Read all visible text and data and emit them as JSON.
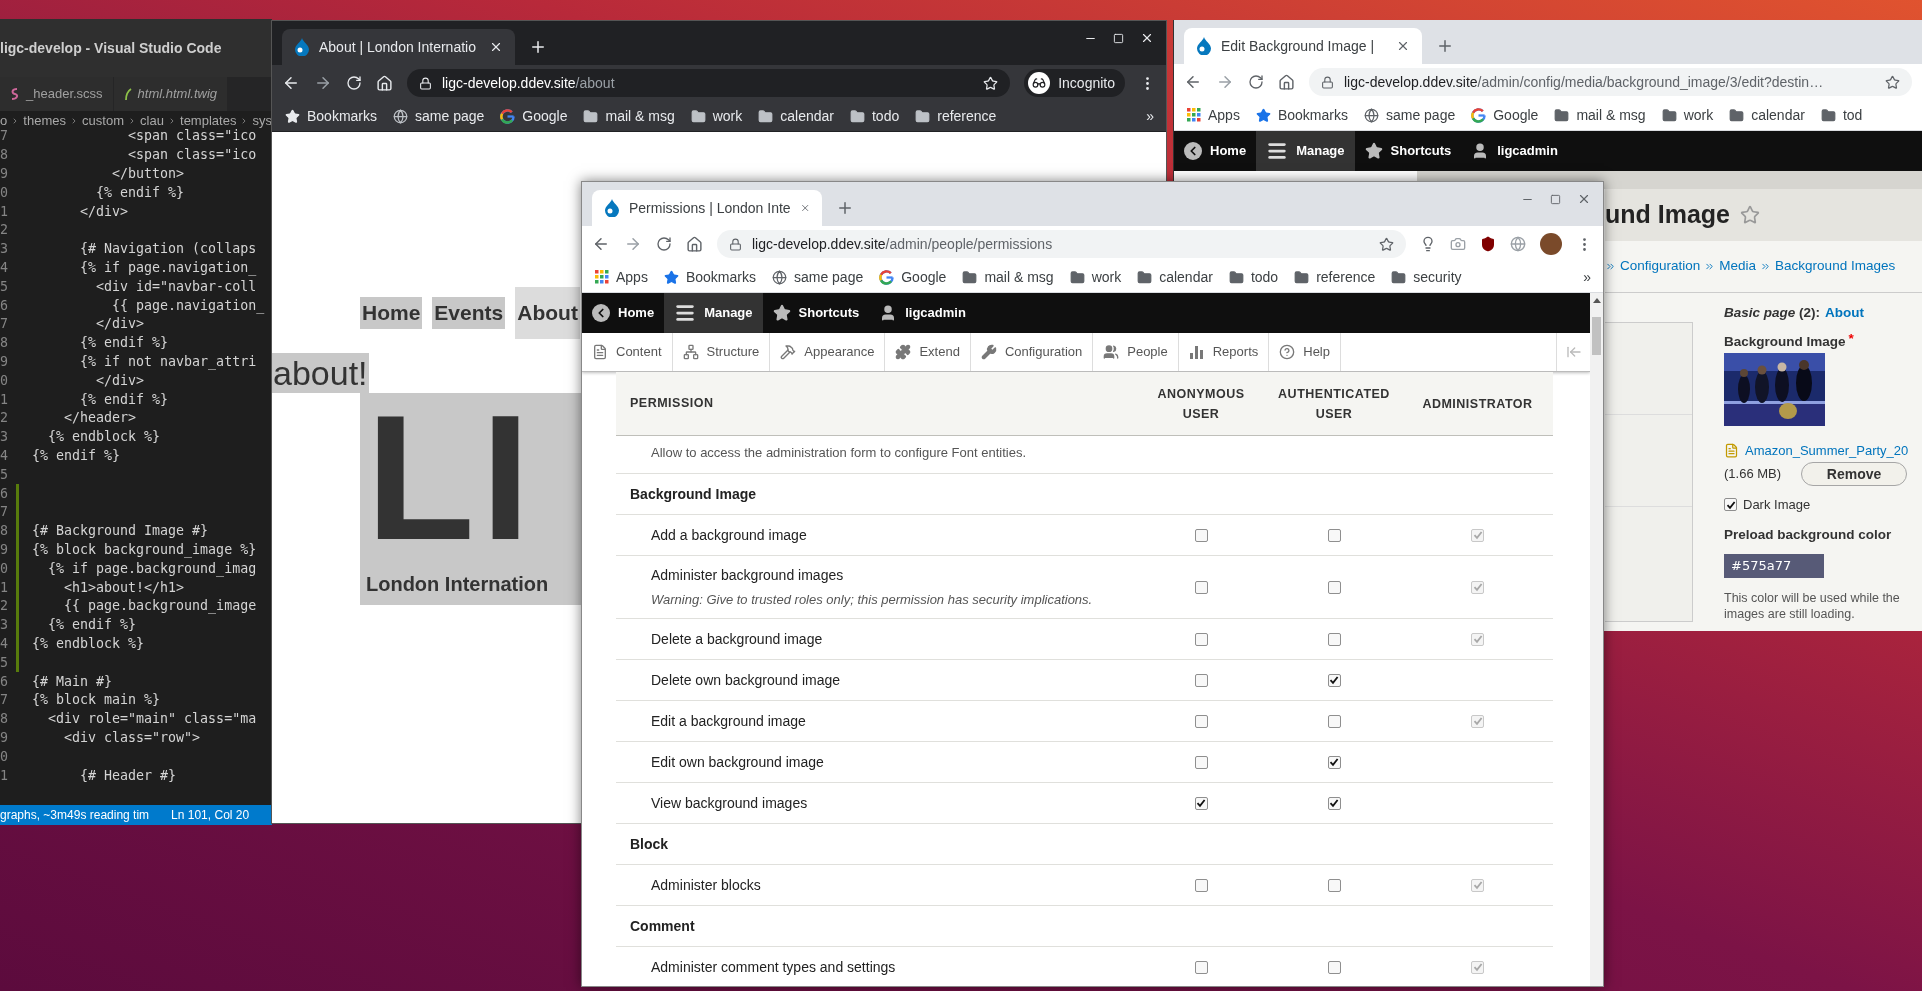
{
  "vscode": {
    "title": "ligc-develop - Visual Studio Code",
    "tabs": [
      {
        "label": "_header.scss",
        "kind": "scss"
      },
      {
        "label": "html.html.twig",
        "kind": "preview"
      }
    ],
    "breadcrumb": [
      "o",
      "themes",
      "custom",
      "clau",
      "templates",
      "sys"
    ],
    "lines": [
      {
        "number": "7",
        "text": "            <span class=\"ico",
        "modified": false
      },
      {
        "number": "8",
        "text": "            <span class=\"ico",
        "modified": false
      },
      {
        "number": "9",
        "text": "          </button>",
        "modified": false
      },
      {
        "number": "0",
        "text": "        {% endif %}",
        "modified": false
      },
      {
        "number": "1",
        "text": "      </div>",
        "modified": false
      },
      {
        "number": "2",
        "modified": false
      },
      {
        "number": "3",
        "text": "      {# Navigation (collaps",
        "modified": false
      },
      {
        "number": "4",
        "text": "      {% if page.navigation_",
        "modified": false
      },
      {
        "number": "5",
        "text": "        <div id=\"navbar-coll",
        "modified": false
      },
      {
        "number": "6",
        "text": "          {{ page.navigation_",
        "modified": false
      },
      {
        "number": "7",
        "text": "        </div>",
        "modified": false
      },
      {
        "number": "8",
        "text": "      {% endif %}",
        "modified": false
      },
      {
        "number": "9",
        "text": "      {% if not navbar_attri",
        "modified": false
      },
      {
        "number": "0",
        "text": "        </div>",
        "modified": false
      },
      {
        "number": "1",
        "text": "      {% endif %}",
        "modified": false
      },
      {
        "number": "2",
        "text": "    </header>",
        "modified": false
      },
      {
        "number": "3",
        "text": "  {% endblock %}",
        "modified": false
      },
      {
        "number": "4",
        "text": "{% endif %}",
        "modified": false
      },
      {
        "number": "5",
        "modified": false
      },
      {
        "number": "6",
        "modified": true
      },
      {
        "number": "7",
        "modified": true
      },
      {
        "number": "8",
        "text": "{# Background Image #}",
        "modified": true
      },
      {
        "number": "9",
        "text": "{% block background_image %}",
        "modified": true
      },
      {
        "number": "0",
        "text": "  {% if page.background_imag",
        "modified": true
      },
      {
        "number": "1",
        "text": "    <h1>about!</h1>",
        "modified": true
      },
      {
        "number": "2",
        "text": "    {{ page.background_image",
        "modified": true
      },
      {
        "number": "3",
        "text": "  {% endif %}",
        "modified": true
      },
      {
        "number": "4",
        "text": "{% endblock %}",
        "modified": true
      },
      {
        "number": "5",
        "modified": true
      },
      {
        "number": "6",
        "text": "{# Main #}",
        "modified": false
      },
      {
        "number": "7",
        "text": "{% block main %}",
        "modified": false
      },
      {
        "number": "8",
        "text": "  <div role=\"main\" class=\"ma",
        "modified": false
      },
      {
        "number": "9",
        "text": "    <div class=\"row\">",
        "modified": false
      },
      {
        "number": "0",
        "modified": false
      },
      {
        "number": "1",
        "text": "      {# Header #}",
        "modified": false
      }
    ],
    "status_bar": {
      "left": "graphs, ~3m49s reading tim",
      "position": "Ln 101, Col 20"
    }
  },
  "about_window": {
    "tab_title": "About | London Internatio",
    "incognito": true,
    "profile": "Incognito",
    "url_host": "ligc-develop.ddev.site",
    "url_path": "/about",
    "bookmarks": [
      {
        "label": "Bookmarks",
        "kind": "star"
      },
      {
        "label": "same page",
        "kind": "globe"
      },
      {
        "label": "Google",
        "kind": "google"
      },
      {
        "label": "mail & msg",
        "kind": "folder"
      },
      {
        "label": "work",
        "kind": "folder"
      },
      {
        "label": "calendar",
        "kind": "folder"
      },
      {
        "label": "todo",
        "kind": "folder"
      },
      {
        "label": "reference",
        "kind": "folder"
      }
    ],
    "bookmarks_more": "»",
    "page": {
      "nav": [
        {
          "label": "Home",
          "selected": false
        },
        {
          "label": "Events",
          "selected": false
        },
        {
          "label": "About",
          "selected": true
        }
      ],
      "heading": "about!",
      "logo_text": "LI",
      "site_name": "London Internation"
    }
  },
  "edit_window": {
    "tab_title": "Edit Background Image |",
    "incognito": false,
    "url_host": "ligc-develop.ddev.site",
    "url_path": "/admin/config/media/background_image/3/edit?destin…",
    "bookmarks": [
      {
        "label": "Apps",
        "kind": "apps"
      },
      {
        "label": "Bookmarks",
        "kind": "star"
      },
      {
        "label": "same page",
        "kind": "globe"
      },
      {
        "label": "Google",
        "kind": "google"
      },
      {
        "label": "mail & msg",
        "kind": "folder"
      },
      {
        "label": "work",
        "kind": "folder"
      },
      {
        "label": "calendar",
        "kind": "folder"
      },
      {
        "label": "tod",
        "kind": "folder"
      }
    ],
    "toolbar": [
      {
        "label": "Home",
        "kind": "home",
        "selected": false
      },
      {
        "label": "Manage",
        "kind": "manage",
        "selected": true
      },
      {
        "label": "Shortcuts",
        "kind": "shortcuts",
        "selected": false
      },
      {
        "label": "ligcadmin",
        "kind": "user",
        "selected": false
      }
    ],
    "page": {
      "title": "und Image",
      "breadcrumb": [
        "Configuration",
        "Media",
        "Background Images"
      ],
      "content_type": "*Basic page* (2):",
      "content_link": "About",
      "image_label": "Background Image",
      "required_mark": "*",
      "file_name": "Amazon_Summer_Party_20",
      "file_size": "(1.66 MB)",
      "remove_button": "Remove",
      "dark_image": {
        "label": "Dark Image",
        "checked": true
      },
      "color_label": "Preload background color",
      "color_value": "#575a77",
      "help_lines": [
        "This color will be used while the",
        "images are still loading."
      ]
    }
  },
  "permissions_window": {
    "tab_title": "Permissions | London Inte",
    "incognito": false,
    "url_host": "ligc-develop.ddev.site",
    "url_path": "/admin/people/permissions",
    "bookmarks": [
      {
        "label": "Apps",
        "kind": "apps"
      },
      {
        "label": "Bookmarks",
        "kind": "star"
      },
      {
        "label": "same page",
        "kind": "globe"
      },
      {
        "label": "Google",
        "kind": "google"
      },
      {
        "label": "mail & msg",
        "kind": "folder"
      },
      {
        "label": "work",
        "kind": "folder"
      },
      {
        "label": "calendar",
        "kind": "folder"
      },
      {
        "label": "todo",
        "kind": "folder"
      },
      {
        "label": "reference",
        "kind": "folder"
      },
      {
        "label": "security",
        "kind": "folder"
      }
    ],
    "bookmarks_more": "»",
    "toolbar": [
      {
        "label": "Home",
        "kind": "home",
        "selected": false
      },
      {
        "label": "Manage",
        "kind": "manage",
        "selected": true
      },
      {
        "label": "Shortcuts",
        "kind": "shortcuts",
        "selected": false
      },
      {
        "label": "ligcadmin",
        "kind": "user",
        "selected": false
      }
    ],
    "tray": [
      {
        "label": "Content",
        "kind": "content"
      },
      {
        "label": "Structure",
        "kind": "structure"
      },
      {
        "label": "Appearance",
        "kind": "appearance"
      },
      {
        "label": "Extend",
        "kind": "extend"
      },
      {
        "label": "Configuration",
        "kind": "configuration"
      },
      {
        "label": "People",
        "kind": "people"
      },
      {
        "label": "Reports",
        "kind": "reports"
      },
      {
        "label": "Help",
        "kind": "help"
      }
    ],
    "columns": [
      "PERMISSION",
      [
        "ANONYMOUS",
        "USER"
      ],
      [
        "AUTHENTICATED",
        "USER"
      ],
      "ADMINISTRATOR"
    ],
    "rows": [
      {
        "kind": "description",
        "text": "Allow to access the administration form to configure Font entities."
      },
      {
        "kind": "group",
        "text": "Background Image"
      },
      {
        "kind": "permission",
        "text": "Add a background image",
        "anonymous": {
          "checked": false,
          "disabled": false
        },
        "authenticated": {
          "checked": false,
          "disabled": false
        },
        "administrator": {
          "checked": true,
          "disabled": true
        }
      },
      {
        "kind": "permission",
        "text": "Administer background images",
        "warning": "Warning: Give to trusted roles only; this permission has security implications.",
        "anonymous": {
          "checked": false,
          "disabled": false
        },
        "authenticated": {
          "checked": false,
          "disabled": false
        },
        "administrator": {
          "checked": true,
          "disabled": true
        }
      },
      {
        "kind": "permission",
        "text": "Delete a background image",
        "anonymous": {
          "checked": false,
          "disabled": false
        },
        "authenticated": {
          "checked": false,
          "disabled": false
        },
        "administrator": {
          "checked": true,
          "disabled": true
        }
      },
      {
        "kind": "permission",
        "text": "Delete own background image",
        "anonymous": {
          "checked": false,
          "disabled": false
        },
        "authenticated": {
          "checked": true,
          "disabled": false
        }
      },
      {
        "kind": "permission",
        "text": "Edit a background image",
        "anonymous": {
          "checked": false,
          "disabled": false
        },
        "authenticated": {
          "checked": false,
          "disabled": false
        },
        "administrator": {
          "checked": true,
          "disabled": true
        }
      },
      {
        "kind": "permission",
        "text": "Edit own background image",
        "anonymous": {
          "checked": false,
          "disabled": false
        },
        "authenticated": {
          "checked": true,
          "disabled": false
        }
      },
      {
        "kind": "permission",
        "text": "View background images",
        "anonymous": {
          "checked": true,
          "disabled": false
        },
        "authenticated": {
          "checked": true,
          "disabled": false
        }
      },
      {
        "kind": "group",
        "text": "Block"
      },
      {
        "kind": "permission",
        "text": "Administer blocks",
        "anonymous": {
          "checked": false,
          "disabled": false
        },
        "authenticated": {
          "checked": false,
          "disabled": false
        },
        "administrator": {
          "checked": true,
          "disabled": true
        }
      },
      {
        "kind": "group",
        "text": "Comment"
      },
      {
        "kind": "permission",
        "text": "Administer comment types and settings",
        "anonymous": {
          "checked": false,
          "disabled": false
        },
        "authenticated": {
          "checked": false,
          "disabled": false
        },
        "administrator": {
          "checked": true,
          "disabled": true
        }
      }
    ]
  }
}
